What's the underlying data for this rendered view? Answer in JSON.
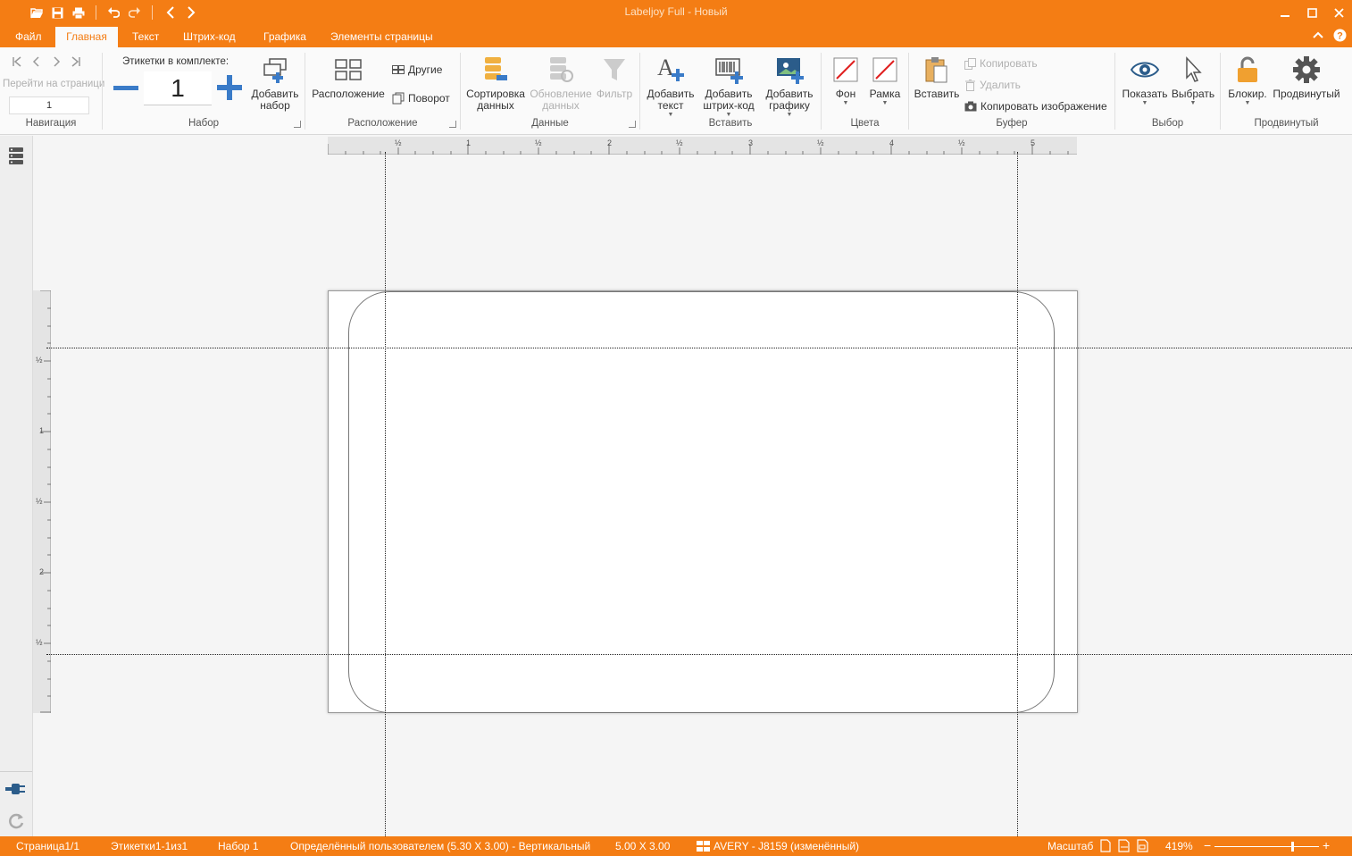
{
  "app": {
    "title": "Labeljoy Full - Новый"
  },
  "tabs": [
    {
      "label": "Файл"
    },
    {
      "label": "Главная"
    },
    {
      "label": "Текст"
    },
    {
      "label": "Штрих-код"
    },
    {
      "label": "Графика"
    },
    {
      "label": "Элементы страницы"
    }
  ],
  "ribbon": {
    "nav": {
      "goto_label": "Перейти на страници",
      "page_value": "1",
      "group": "Навигация"
    },
    "set": {
      "labels_in_kit": "Этикетки в комплекте:",
      "count": "1",
      "add_set": "Добавить набор",
      "group": "Набор"
    },
    "layout": {
      "layout": "Расположение",
      "other": "Другие",
      "rotate": "Поворот",
      "group": "Расположение"
    },
    "data": {
      "sort": "Сортировка данных",
      "update": "Обновление данных",
      "filter": "Фильтр",
      "group": "Данные"
    },
    "insert": {
      "add_text": "Добавить текст",
      "add_barcode": "Добавить штрих-код",
      "add_graphic": "Добавить графику",
      "group": "Вставить"
    },
    "colors": {
      "background": "Фон",
      "frame": "Рамка",
      "group": "Цвета"
    },
    "buffer": {
      "paste": "Вставить",
      "copy": "Копировать",
      "delete": "Удалить",
      "copy_image": "Копировать изображение",
      "group": "Буфер"
    },
    "select": {
      "show": "Показать",
      "select": "Выбрать",
      "group": "Выбор"
    },
    "advanced": {
      "lock": "Блокир.",
      "advanced": "Продвинутый",
      "group": "Продвинутый"
    }
  },
  "ruler": {
    "h": [
      "½",
      "1",
      "½",
      "2",
      "½",
      "3",
      "½",
      "4",
      "½",
      "5"
    ],
    "v": [
      "½",
      "1",
      "½",
      "2",
      "½"
    ]
  },
  "status": {
    "page": "Страница1/1",
    "labels": "Этикетки1-1из1",
    "set": "Набор 1",
    "custom": "Определённый пользователем (5.30 X 3.00) - Вертикальный",
    "size": "5.00 X 3.00",
    "template": "AVERY - J8159 (изменённый)",
    "scale_label": "Масштаб",
    "zoom": "419%"
  },
  "colors": {
    "accent": "#f47d14",
    "blue": "#3a7bc8"
  }
}
